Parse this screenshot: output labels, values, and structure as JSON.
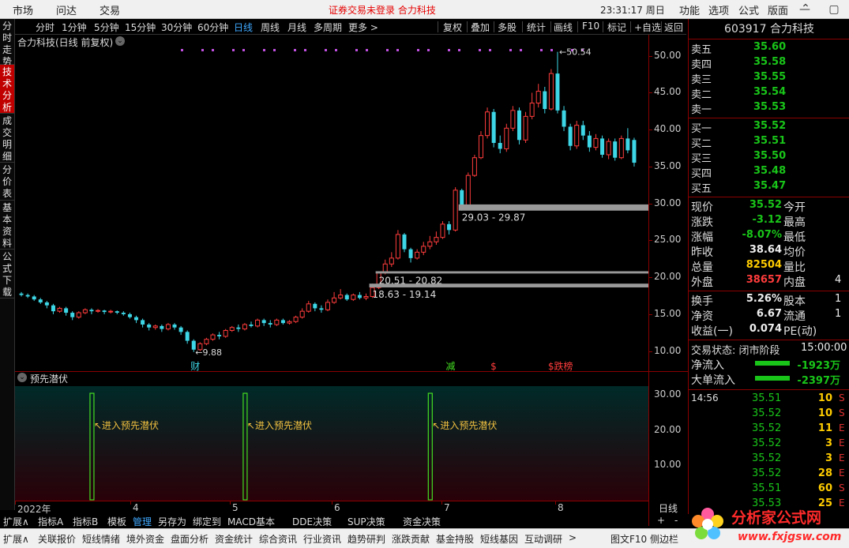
{
  "topbar": {
    "menus": [
      "市场",
      "问达",
      "交易"
    ],
    "login_msg": "证券交易未登录  合力科技",
    "clock": "23:31:17 周日",
    "right_menus": [
      "功能",
      "选项",
      "公式",
      "版面"
    ]
  },
  "vtabs": [
    "分时走势",
    "技术分析",
    "成交明细",
    "分价表",
    "基本资料",
    "公式下载"
  ],
  "periods": [
    "分时",
    "1分钟",
    "5分钟",
    "15分钟",
    "30分钟",
    "60分钟",
    "日线",
    "周线",
    "月线",
    "多周期",
    "更多 >"
  ],
  "selected_period": "日线",
  "tools": [
    "复权",
    "叠加",
    "多股",
    "统计",
    "画线",
    "F10",
    "标记",
    "+自选",
    "返回"
  ],
  "chart_header": "合力科技(日线 前复权)",
  "indicator_header": "预先潜伏",
  "colors": {
    "up": "#ff3c3c",
    "down": "#3dd6e6",
    "signal": "#44dd22",
    "accent": "#3fa9ff"
  },
  "chart_data": {
    "type": "candlestick",
    "title": "合力科技(日线 前复权)",
    "ylim": [
      9.0,
      52.0
    ],
    "yticks": [
      10.0,
      15.0,
      20.0,
      25.0,
      30.0,
      35.0,
      40.0,
      45.0,
      50.0
    ],
    "xlabels": [
      "2022年",
      "4",
      "5",
      "6",
      "7",
      "8"
    ],
    "low_marker": "9.88",
    "high_marker": "50.54",
    "zones": [
      {
        "label": "29.03 - 29.87",
        "low": 29.03,
        "high": 29.87
      },
      {
        "label": "20.51 - 20.82",
        "low": 20.51,
        "high": 20.82
      },
      {
        "label": "18.63 - 19.14",
        "low": 18.63,
        "high": 19.14
      }
    ],
    "events": [
      "财",
      "减",
      "$",
      "$跌榜"
    ],
    "candles": [
      [
        17.8,
        17.6,
        18.0,
        17.4
      ],
      [
        17.6,
        17.4,
        17.8,
        17.2
      ],
      [
        17.4,
        17.0,
        17.6,
        16.8
      ],
      [
        17.0,
        16.6,
        17.2,
        16.4
      ],
      [
        16.6,
        16.2,
        16.8,
        15.8
      ],
      [
        16.2,
        15.4,
        16.4,
        15.0
      ],
      [
        15.4,
        15.8,
        16.0,
        15.2
      ],
      [
        15.8,
        15.2,
        16.0,
        14.8
      ],
      [
        15.2,
        14.6,
        15.4,
        14.2
      ],
      [
        14.6,
        15.2,
        15.4,
        14.4
      ],
      [
        15.2,
        15.6,
        15.8,
        15.0
      ],
      [
        15.6,
        15.4,
        15.8,
        15.0
      ],
      [
        15.4,
        15.5,
        15.7,
        15.2
      ],
      [
        15.5,
        15.3,
        15.6,
        15.0
      ],
      [
        15.3,
        15.4,
        15.6,
        15.1
      ],
      [
        15.4,
        15.2,
        15.5,
        15.0
      ],
      [
        15.2,
        15.0,
        15.4,
        14.8
      ],
      [
        15.0,
        14.6,
        15.2,
        14.4
      ],
      [
        14.6,
        14.2,
        14.8,
        13.8
      ],
      [
        14.2,
        13.6,
        14.4,
        13.2
      ],
      [
        13.6,
        13.2,
        13.8,
        12.8
      ],
      [
        13.2,
        13.4,
        13.6,
        12.9
      ],
      [
        13.4,
        13.0,
        13.6,
        12.6
      ],
      [
        13.0,
        13.6,
        13.8,
        12.8
      ],
      [
        13.6,
        13.2,
        13.8,
        12.9
      ],
      [
        13.2,
        12.6,
        13.4,
        12.2
      ],
      [
        12.6,
        11.4,
        12.8,
        11.0
      ],
      [
        11.4,
        10.2,
        11.6,
        9.88
      ],
      [
        10.2,
        11.0,
        11.2,
        10.0
      ],
      [
        11.0,
        11.6,
        11.8,
        10.8
      ],
      [
        11.6,
        12.2,
        12.4,
        11.4
      ],
      [
        12.2,
        12.0,
        12.6,
        11.6
      ],
      [
        12.0,
        12.8,
        13.0,
        11.8
      ],
      [
        12.8,
        13.2,
        13.4,
        12.6
      ],
      [
        13.2,
        13.0,
        13.6,
        12.6
      ],
      [
        13.0,
        13.6,
        13.8,
        12.8
      ],
      [
        13.6,
        13.4,
        14.0,
        13.2
      ],
      [
        13.4,
        14.2,
        14.4,
        13.2
      ],
      [
        14.2,
        13.8,
        14.4,
        13.4
      ],
      [
        13.8,
        13.6,
        14.2,
        13.2
      ],
      [
        13.6,
        14.2,
        14.4,
        13.4
      ],
      [
        14.2,
        13.8,
        14.4,
        13.6
      ],
      [
        13.8,
        14.0,
        14.2,
        13.6
      ],
      [
        14.0,
        14.6,
        14.8,
        13.8
      ],
      [
        14.6,
        15.4,
        15.8,
        14.4
      ],
      [
        15.4,
        16.4,
        16.8,
        15.2
      ],
      [
        16.4,
        15.8,
        16.6,
        15.4
      ],
      [
        15.8,
        15.6,
        16.2,
        15.2
      ],
      [
        15.6,
        16.6,
        17.0,
        15.4
      ],
      [
        16.6,
        17.2,
        18.0,
        16.4
      ],
      [
        17.2,
        17.6,
        18.4,
        17.0
      ],
      [
        17.6,
        17.0,
        17.8,
        16.8
      ],
      [
        17.0,
        17.6,
        17.8,
        16.8
      ],
      [
        17.6,
        17.2,
        18.0,
        17.0
      ],
      [
        17.2,
        17.4,
        17.8,
        16.9
      ],
      [
        17.4,
        18.6,
        19.14,
        17.2
      ],
      [
        18.6,
        20.6,
        20.82,
        18.4
      ],
      [
        20.6,
        21.8,
        22.4,
        20.4
      ],
      [
        21.8,
        22.6,
        23.4,
        21.4
      ],
      [
        22.6,
        25.8,
        26.4,
        22.4
      ],
      [
        25.8,
        23.8,
        26.0,
        23.4
      ],
      [
        23.8,
        22.6,
        24.0,
        22.0
      ],
      [
        22.6,
        23.4,
        23.8,
        22.4
      ],
      [
        23.4,
        24.2,
        24.8,
        23.0
      ],
      [
        24.2,
        24.8,
        25.6,
        23.8
      ],
      [
        24.8,
        25.4,
        26.2,
        24.4
      ],
      [
        25.4,
        27.2,
        27.6,
        25.2
      ],
      [
        27.2,
        26.4,
        27.6,
        25.8
      ],
      [
        26.4,
        31.8,
        32.2,
        26.2
      ],
      [
        31.8,
        29.4,
        32.0,
        29.03
      ],
      [
        29.4,
        33.8,
        34.2,
        29.2
      ],
      [
        33.8,
        36.2,
        36.6,
        33.6
      ],
      [
        36.2,
        39.2,
        39.8,
        36.0
      ],
      [
        39.2,
        42.4,
        43.0,
        38.8
      ],
      [
        42.4,
        38.2,
        42.8,
        37.6
      ],
      [
        38.2,
        37.4,
        39.2,
        36.8
      ],
      [
        37.4,
        40.2,
        40.8,
        37.0
      ],
      [
        40.2,
        42.6,
        43.2,
        39.8
      ],
      [
        42.6,
        38.6,
        43.0,
        38.0
      ],
      [
        38.6,
        41.8,
        42.4,
        38.2
      ],
      [
        41.8,
        43.6,
        45.0,
        41.4
      ],
      [
        43.6,
        45.2,
        46.2,
        43.0
      ],
      [
        45.2,
        42.8,
        45.8,
        42.2
      ],
      [
        42.8,
        47.6,
        48.2,
        42.6
      ],
      [
        47.6,
        42.6,
        50.54,
        42.2
      ],
      [
        42.6,
        40.4,
        43.2,
        39.8
      ],
      [
        40.4,
        37.8,
        40.8,
        37.2
      ],
      [
        37.8,
        40.6,
        41.2,
        37.4
      ],
      [
        40.6,
        39.2,
        41.2,
        38.6
      ],
      [
        39.2,
        37.6,
        39.8,
        37.0
      ],
      [
        37.6,
        38.8,
        39.4,
        37.2
      ],
      [
        38.8,
        36.6,
        39.2,
        36.2
      ],
      [
        36.6,
        38.4,
        38.8,
        36.0
      ],
      [
        38.4,
        36.2,
        38.8,
        35.8
      ],
      [
        36.2,
        38.8,
        39.2,
        36.0
      ],
      [
        38.8,
        37.2,
        40.2,
        36.8
      ],
      [
        38.6,
        35.52,
        38.9,
        35.0
      ]
    ],
    "indicator": {
      "name": "预先潜伏",
      "ylim": [
        0,
        33
      ],
      "yticks": [
        10.0,
        20.0,
        30.0
      ],
      "signal_label": "进入预先潜伏",
      "signal_index": [
        11,
        35,
        64
      ]
    }
  },
  "quote": {
    "code_name": "603917 合力科技",
    "asks": [
      {
        "label": "卖五",
        "price": "35.60"
      },
      {
        "label": "卖四",
        "price": "35.58"
      },
      {
        "label": "卖三",
        "price": "35.55"
      },
      {
        "label": "卖二",
        "price": "35.54"
      },
      {
        "label": "卖一",
        "price": "35.53"
      }
    ],
    "bids": [
      {
        "label": "买一",
        "price": "35.52"
      },
      {
        "label": "买二",
        "price": "35.51"
      },
      {
        "label": "买三",
        "price": "35.50"
      },
      {
        "label": "买四",
        "price": "35.48"
      },
      {
        "label": "买五",
        "price": "35.47"
      }
    ],
    "stats": [
      {
        "k": "现价",
        "v": "35.52",
        "cls": "green",
        "k2": "今开",
        "v2": ""
      },
      {
        "k": "涨跌",
        "v": "-3.12",
        "cls": "green",
        "k2": "最高",
        "v2": ""
      },
      {
        "k": "涨幅",
        "v": "-8.07%",
        "cls": "green",
        "k2": "最低",
        "v2": ""
      },
      {
        "k": "昨收",
        "v": "38.64",
        "cls": "wht",
        "k2": "均价",
        "v2": ""
      },
      {
        "k": "总量",
        "v": "82504",
        "cls": "yel",
        "k2": "量比",
        "v2": ""
      },
      {
        "k": "外盘",
        "v": "38657",
        "cls": "red",
        "k2": "内盘",
        "v2": "4"
      }
    ],
    "stats2": [
      {
        "k": "换手",
        "v": "5.26%",
        "k2": "股本",
        "v2": "1"
      },
      {
        "k": "净资",
        "v": "6.67",
        "k2": "流通",
        "v2": "1"
      },
      {
        "k": "收益(一)",
        "v": "0.074",
        "k2": "PE(动)",
        "v2": ""
      }
    ],
    "status_label": "交易状态: 闭市阶段",
    "status_time": "15:00:00",
    "flows": [
      {
        "k": "净流入",
        "v": "-1923万"
      },
      {
        "k": "大单流入",
        "v": "-2397万"
      }
    ],
    "ticks": [
      {
        "t": "14:56",
        "p": "35.51",
        "v": "10",
        "d": "S"
      },
      {
        "t": "",
        "p": "35.52",
        "v": "10",
        "d": "S"
      },
      {
        "t": "",
        "p": "35.52",
        "v": "11",
        "d": "E"
      },
      {
        "t": "",
        "p": "35.52",
        "v": "3",
        "d": "E"
      },
      {
        "t": "",
        "p": "35.52",
        "v": "3",
        "d": "E"
      },
      {
        "t": "",
        "p": "35.52",
        "v": "28",
        "d": "E"
      },
      {
        "t": "",
        "p": "35.51",
        "v": "60",
        "d": "S"
      },
      {
        "t": "",
        "p": "35.53",
        "v": "25",
        "d": "E"
      }
    ]
  },
  "xright": {
    "label": "日线"
  },
  "bottom_tabs": [
    "扩展∧",
    "指标A",
    "指标B",
    "模板",
    "管理",
    "另存为",
    "绑定到",
    "MACD基本",
    "DDE决策",
    "SUP决策",
    "资金决策"
  ],
  "bottom_tabs_sel": "管理",
  "bottom_tabs2": [
    "扩展∧",
    "关联报价",
    "短线情绪",
    "境外资金",
    "盘面分析",
    "资金统计",
    "综合资讯",
    "行业资讯",
    "趋势研判",
    "涨跌贡献",
    "基金持股",
    "短线基因",
    "互动调研",
    ">"
  ],
  "status_right": "图文F10 侧边栏",
  "logo": {
    "text": "分析家公式网",
    "url": "www.fxjgsw.com"
  }
}
